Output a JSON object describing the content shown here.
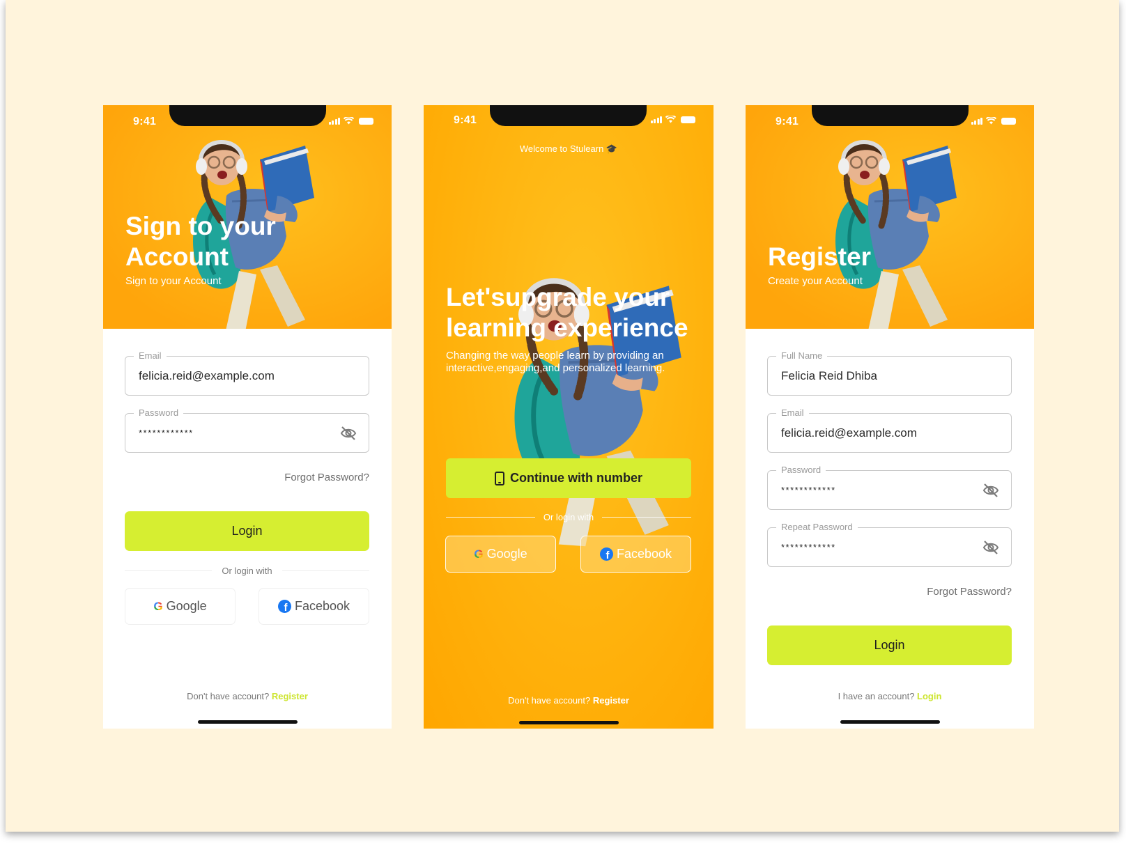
{
  "status_bar": {
    "time": "9:41"
  },
  "login_screen": {
    "title_line1": "Sign to your",
    "title_line2": "Account",
    "subtitle": "Sign to your Account",
    "email": {
      "label": "Email",
      "value": "felicia.reid@example.com"
    },
    "password": {
      "label": "Password",
      "value": "************"
    },
    "forgot_password": "Forgot Password?",
    "login_button": "Login",
    "or_login_with": "Or login with",
    "google_label": "Google",
    "facebook_label": "Facebook",
    "footer_prompt": "Don't have account?",
    "footer_link": "Register"
  },
  "welcome_screen": {
    "welcome_text": "Welcome to Stulearn 🎓",
    "title_line1": "Let'supgrade your",
    "title_line2": "learning experience",
    "description": "Changing the way people learn by providing an interactive,engaging,and personalized learning.",
    "continue_button": "Continue with number",
    "or_login_with": "Or login with",
    "google_label": "Google",
    "facebook_label": "Facebook",
    "footer_prompt": "Don't have account?",
    "footer_link": "Register"
  },
  "register_screen": {
    "title": "Register",
    "subtitle": "Create your Account",
    "full_name": {
      "label": "Full Name",
      "value": "Felicia Reid Dhiba"
    },
    "email": {
      "label": "Email",
      "value": "felicia.reid@example.com"
    },
    "password": {
      "label": "Password",
      "value": "************"
    },
    "repeat_password": {
      "label": "Repeat Password",
      "value": "************"
    },
    "forgot_password": "Forgot Password?",
    "login_button": "Login",
    "footer_prompt": "I have an account?",
    "footer_link": "Login"
  },
  "colors": {
    "accent_lime": "#d6ee31",
    "hero_orange": "#ffa50b",
    "background_cream": "#fff4dc"
  }
}
